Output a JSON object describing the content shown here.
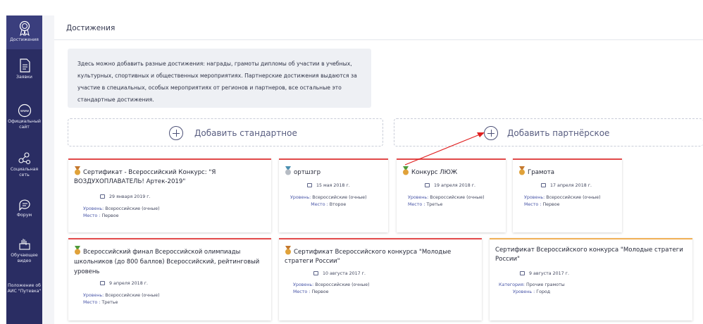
{
  "sidebar": {
    "items": [
      {
        "label": "Достижения",
        "icon": "medal-icon"
      },
      {
        "label": "Заявки",
        "icon": "document-icon"
      },
      {
        "label": "Официальный сайт",
        "icon": "www-icon"
      },
      {
        "label": "Социальная сеть",
        "icon": "network-icon"
      },
      {
        "label": "Форум",
        "icon": "chat-icon"
      },
      {
        "label": "Обучающее видео",
        "icon": "video-icon"
      },
      {
        "label": "Положение об АИС \"Путевка\"",
        "icon": "info-icon"
      }
    ]
  },
  "page": {
    "title": "Достижения",
    "info_text": "Здесь можно добавить разные достижения: награды, грамоты дипломы об участии в учебных, культурных, спортивных и общественных мероприятиях. Партнерские достижения выдаются за участие в специальных, особых мероприятиях от регионов и партнеров, все остальные это стандартные достижения.",
    "add_standard": "Добавить стандартное",
    "add_partner": "Добавить партнёрское"
  },
  "labels": {
    "level": "Уровень:",
    "place": "Место :",
    "category": "Категория:",
    "level2": "Уровень :"
  },
  "cards": [
    {
      "title": "Сертификат - Всероссийский Конкурс: \"Я ВОЗДУХОПЛАВАТЕЛЬ! Артек-2019\"",
      "date": "29 января 2019 г.",
      "level": "Всероссийские (очные)",
      "place": "Первое",
      "medal": "bronze"
    },
    {
      "title": "оpтшзгр",
      "date": "15 мая 2018 г.",
      "level": "Всероссийские (очные)",
      "place": "Второе",
      "medal": "silver"
    },
    {
      "title": "Конкурс ЛЮЖ",
      "date": "19 апреля 2018 г.",
      "level": "Всероссийские (очные)",
      "place": "Третье",
      "medal": "green"
    },
    {
      "title": "Грамота",
      "date": "17 апреля 2018 г.",
      "level": "Всероссийские (очные)",
      "place": "Первое",
      "medal": "bronze"
    },
    {
      "title": "Всероссийский финал Всероссийской олимпиады школьников (до 800 баллов) Всероссийский, рейтинговый уровень",
      "date": "9 апреля 2018 г.",
      "level": "Всероссийские (очные)",
      "place": "Третье",
      "medal": "green"
    },
    {
      "title": "Сертификат Всероссийского конкурса \"Молодые стратеги России\"",
      "date": "10 августа 2017 г.",
      "level": "Всероссийские (очные)",
      "place": "Первое",
      "medal": "bronze"
    },
    {
      "title": "Сертификат Всероссийского конкурса \"Молодые стратеги России\"",
      "date": "9 августа 2017 г.",
      "category": "Прочие грамоты",
      "level": "Город",
      "medal": "none"
    }
  ],
  "colors": {
    "sidebar": "#2a2d63",
    "card_accent": "#e34b4b",
    "card_accent_alt": "#f0b056",
    "arrow": "#e02020",
    "medal_bronze": "#c4782e",
    "medal_silver": "#4a8fb0",
    "medal_green": "#4f9a3a"
  }
}
